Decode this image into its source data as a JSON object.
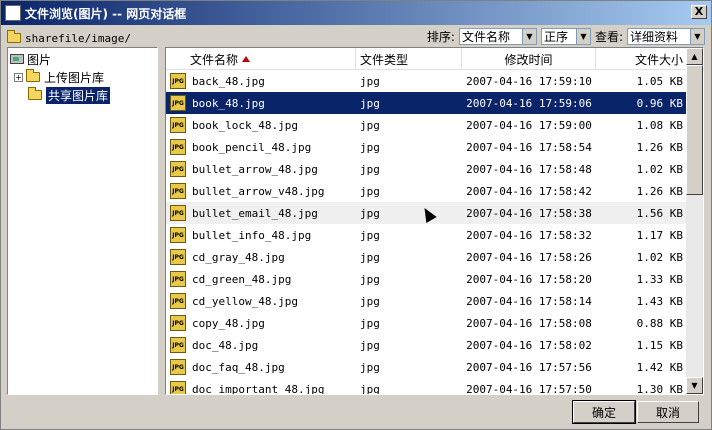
{
  "window": {
    "title": "文件浏览(图片) -- 网页对话框",
    "close_label": "X"
  },
  "path": {
    "text": "sharefile/image/"
  },
  "controls": {
    "sort_label": "排序:",
    "sort_by": "文件名称",
    "sort_order": "正序",
    "view_label": "查看:",
    "view_mode": "详细资料"
  },
  "tree": {
    "root": "图片",
    "items": [
      {
        "label": "上传图片库"
      },
      {
        "label": "共享图片库"
      }
    ]
  },
  "columns": [
    "文件名称",
    "文件类型",
    "修改时间",
    "文件大小"
  ],
  "files": [
    {
      "name": "back_48.jpg",
      "type": "jpg",
      "modified": "2007-04-16 17:59:10",
      "size": "1.05 KB"
    },
    {
      "name": "book_48.jpg",
      "type": "jpg",
      "modified": "2007-04-16 17:59:06",
      "size": "0.96 KB"
    },
    {
      "name": "book_lock_48.jpg",
      "type": "jpg",
      "modified": "2007-04-16 17:59:00",
      "size": "1.08 KB"
    },
    {
      "name": "book_pencil_48.jpg",
      "type": "jpg",
      "modified": "2007-04-16 17:58:54",
      "size": "1.26 KB"
    },
    {
      "name": "bullet_arrow_48.jpg",
      "type": "jpg",
      "modified": "2007-04-16 17:58:48",
      "size": "1.02 KB"
    },
    {
      "name": "bullet_arrow_v48.jpg",
      "type": "jpg",
      "modified": "2007-04-16 17:58:42",
      "size": "1.26 KB"
    },
    {
      "name": "bullet_email_48.jpg",
      "type": "jpg",
      "modified": "2007-04-16 17:58:38",
      "size": "1.56 KB"
    },
    {
      "name": "bullet_info_48.jpg",
      "type": "jpg",
      "modified": "2007-04-16 17:58:32",
      "size": "1.17 KB"
    },
    {
      "name": "cd_gray_48.jpg",
      "type": "jpg",
      "modified": "2007-04-16 17:58:26",
      "size": "1.02 KB"
    },
    {
      "name": "cd_green_48.jpg",
      "type": "jpg",
      "modified": "2007-04-16 17:58:20",
      "size": "1.33 KB"
    },
    {
      "name": "cd_yellow_48.jpg",
      "type": "jpg",
      "modified": "2007-04-16 17:58:14",
      "size": "1.43 KB"
    },
    {
      "name": "copy_48.jpg",
      "type": "jpg",
      "modified": "2007-04-16 17:58:08",
      "size": "0.88 KB"
    },
    {
      "name": "doc_48.jpg",
      "type": "jpg",
      "modified": "2007-04-16 17:58:02",
      "size": "1.15 KB"
    },
    {
      "name": "doc_faq_48.jpg",
      "type": "jpg",
      "modified": "2007-04-16 17:57:56",
      "size": "1.42 KB"
    },
    {
      "name": "doc_important_48.jpg",
      "type": "jpg",
      "modified": "2007-04-16 17:57:50",
      "size": "1.30 KB"
    }
  ],
  "selected_index": 1,
  "hover_index": 6,
  "buttons": {
    "ok": "确定",
    "cancel": "取消"
  },
  "icon_text": {
    "jpg": "JPG"
  },
  "colors": {
    "selection": "#0a246a",
    "sort_arrow": "#c00000"
  }
}
